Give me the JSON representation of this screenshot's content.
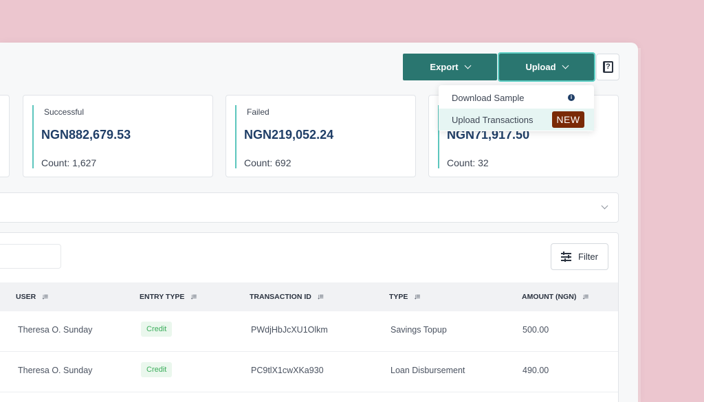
{
  "toolbar": {
    "export_label": "Export",
    "upload_label": "Upload"
  },
  "upload_menu": {
    "items": [
      {
        "label": "Download Sample",
        "icon": "info-icon"
      },
      {
        "label": "Upload Transactions",
        "badge": "NEW"
      }
    ]
  },
  "summary_cards": [
    {
      "label": "Successful",
      "amount": "NGN882,679.53",
      "count": "Count: 1,627"
    },
    {
      "label": "Failed",
      "amount": "NGN219,052.24",
      "count": "Count: 692"
    },
    {
      "label": "",
      "amount": "NGN71,917.50",
      "count": "Count: 32"
    }
  ],
  "table": {
    "filter_label": "Filter",
    "columns": [
      "USER",
      "ENTRY TYPE",
      "TRANSACTION ID",
      "TYPE",
      "AMOUNT (NGN)"
    ],
    "rows": [
      {
        "user": "Theresa O. Sunday",
        "entry_type": "Credit",
        "transaction_id": "PWdjHbJcXU1Olkm",
        "type": "Savings Topup",
        "amount": "500.00"
      },
      {
        "user": "Theresa O. Sunday",
        "entry_type": "Credit",
        "transaction_id": "PC9tlX1cwXKa930",
        "type": "Loan Disbursement",
        "amount": "490.00"
      }
    ]
  },
  "colors": {
    "accent": "#2a7670",
    "highlight": "#5fd0c5",
    "badge_new": "#7a2a06",
    "credit_green": "#3cae5c",
    "amount_navy": "#1f3e67",
    "background_pink": "#ecc6cf"
  }
}
